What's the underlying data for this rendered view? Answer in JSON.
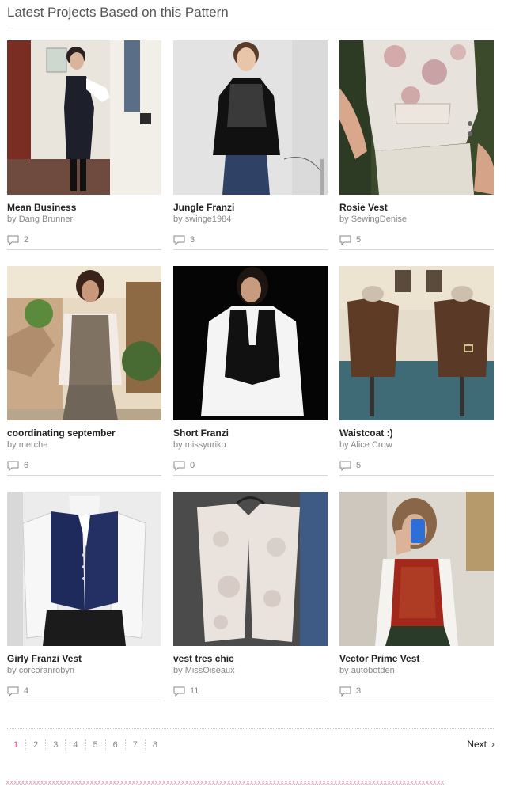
{
  "heading": "Latest Projects Based on this Pattern",
  "projects": [
    {
      "title": "Mean Business",
      "by": "by",
      "user": "Dang Brunner",
      "comments": "2",
      "image": "woman-black-dress"
    },
    {
      "title": "Jungle Franzi",
      "by": "by",
      "user": "swinge1984",
      "comments": "3",
      "image": "woman-black-vest"
    },
    {
      "title": "Rosie Vest",
      "by": "by",
      "user": "SewingDenise",
      "comments": "5",
      "image": "floral-vest-closeup"
    },
    {
      "title": "coordinating september",
      "by": "by",
      "user": "merche",
      "comments": "6",
      "image": "woman-tweed-vest"
    },
    {
      "title": "Short Franzi",
      "by": "by",
      "user": "missyuriko",
      "comments": "0",
      "image": "woman-black-vest-dark-bg"
    },
    {
      "title": "Waistcoat :)",
      "by": "by",
      "user": "Alice Crow",
      "comments": "5",
      "image": "waistcoats-on-forms"
    },
    {
      "title": "Girly Franzi Vest",
      "by": "by",
      "user": "corcoranrobyn",
      "comments": "4",
      "image": "navy-vest-lace-sleeves"
    },
    {
      "title": "vest tres chic",
      "by": "by",
      "user": "MissOiseaux",
      "comments": "11",
      "image": "lace-vest-hanger"
    },
    {
      "title": "Vector Prime Vest",
      "by": "by",
      "user": "autobotden",
      "comments": "3",
      "image": "red-vest-mirror-selfie"
    }
  ],
  "pagination": {
    "pages": [
      "1",
      "2",
      "3",
      "4",
      "5",
      "6",
      "7",
      "8"
    ],
    "current": "1",
    "next_label": "Next",
    "next_icon": "chevron-right-icon"
  },
  "colors": {
    "accent_pink": "#e54a7a",
    "border_x": "#e0a0b8"
  }
}
